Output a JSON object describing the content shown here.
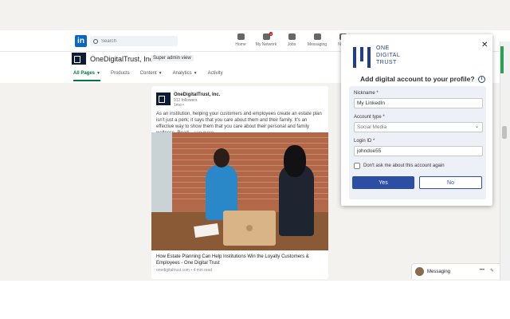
{
  "topnav": {
    "logo": "in",
    "search_placeholder": "Search",
    "items": [
      {
        "label": "Home",
        "badge": ""
      },
      {
        "label": "My Network",
        "badge": "4"
      },
      {
        "label": "Jobs",
        "badge": ""
      },
      {
        "label": "Messaging",
        "badge": ""
      },
      {
        "label": "Notifi",
        "badge": ""
      }
    ]
  },
  "org": {
    "name": "OneDigitalTrust, Inc.",
    "role": "Super admin view",
    "tabs": [
      {
        "label": "All Pages",
        "active": true,
        "caret": "▼"
      },
      {
        "label": "Products",
        "active": false,
        "caret": ""
      },
      {
        "label": "Content",
        "active": false,
        "caret": "▼"
      },
      {
        "label": "Analytics",
        "active": false,
        "caret": "▼"
      },
      {
        "label": "Activity",
        "active": false,
        "caret": ""
      }
    ]
  },
  "post": {
    "author": "OneDigitalTrust, Inc.",
    "followers": "912 followers",
    "time": "1mo •",
    "text": "As an institution, helping your customers and employees create an estate plan isn't just a perk; it says that you care about them and their family. It's an effective way to show them that you care about their personal and family wellness. Read",
    "see_more": "...see more",
    "link_title": "How Estate Planning Can Help Institutions Win the Loyalty Customers & Employees - One Digital Trust",
    "link_meta": "onedigitaltrust.com • 4 min read"
  },
  "messaging": {
    "label": "Messaging",
    "icons": [
      "•••",
      "✎",
      "︿"
    ]
  },
  "popup": {
    "brand": [
      "ONE",
      "DIGITAL",
      "TRUST"
    ],
    "question": "Add digital account to your profile?",
    "info": "i",
    "close": "✕",
    "nickname_label": "Nickname *",
    "nickname_value": "My LinkedIn",
    "account_type_label": "Account type *",
    "account_type_value": "Social Media",
    "login_label": "Login ID *",
    "login_value": "johndoe55",
    "checkbox_label": "Don't ask me about this account again",
    "yes": "Yes",
    "no": "No",
    "accent": "#2c4fa3"
  }
}
